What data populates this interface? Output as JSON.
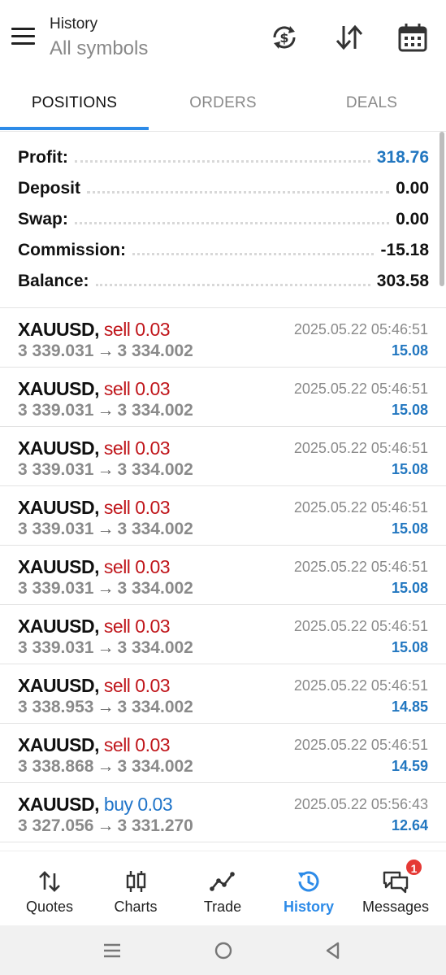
{
  "header": {
    "title": "History",
    "subtitle": "All symbols",
    "icons": [
      "menu-icon",
      "currency-sync-icon",
      "sort-icon",
      "calendar-icon"
    ]
  },
  "tabs": [
    {
      "label": "POSITIONS",
      "active": true
    },
    {
      "label": "ORDERS",
      "active": false
    },
    {
      "label": "DEALS",
      "active": false
    }
  ],
  "summary": {
    "profit_label": "Profit:",
    "profit_value": "318.76",
    "deposit_label": "Deposit",
    "deposit_value": "0.00",
    "swap_label": "Swap:",
    "swap_value": "0.00",
    "commission_label": "Commission:",
    "commission_value": "-15.18",
    "balance_label": "Balance:",
    "balance_value": "303.58"
  },
  "deals": [
    {
      "symbol": "XAUUSD,",
      "side": "sell 0.03",
      "type": "sell",
      "open": "3 339.031",
      "arrow": "→",
      "close": "3 334.002",
      "time": "2025.05.22 05:46:51",
      "profit": "15.08"
    },
    {
      "symbol": "XAUUSD,",
      "side": "sell 0.03",
      "type": "sell",
      "open": "3 339.031",
      "arrow": "→",
      "close": "3 334.002",
      "time": "2025.05.22 05:46:51",
      "profit": "15.08"
    },
    {
      "symbol": "XAUUSD,",
      "side": "sell 0.03",
      "type": "sell",
      "open": "3 339.031",
      "arrow": "→",
      "close": "3 334.002",
      "time": "2025.05.22 05:46:51",
      "profit": "15.08"
    },
    {
      "symbol": "XAUUSD,",
      "side": "sell 0.03",
      "type": "sell",
      "open": "3 339.031",
      "arrow": "→",
      "close": "3 334.002",
      "time": "2025.05.22 05:46:51",
      "profit": "15.08"
    },
    {
      "symbol": "XAUUSD,",
      "side": "sell 0.03",
      "type": "sell",
      "open": "3 339.031",
      "arrow": "→",
      "close": "3 334.002",
      "time": "2025.05.22 05:46:51",
      "profit": "15.08"
    },
    {
      "symbol": "XAUUSD,",
      "side": "sell 0.03",
      "type": "sell",
      "open": "3 339.031",
      "arrow": "→",
      "close": "3 334.002",
      "time": "2025.05.22 05:46:51",
      "profit": "15.08"
    },
    {
      "symbol": "XAUUSD,",
      "side": "sell 0.03",
      "type": "sell",
      "open": "3 338.953",
      "arrow": "→",
      "close": "3 334.002",
      "time": "2025.05.22 05:46:51",
      "profit": "14.85"
    },
    {
      "symbol": "XAUUSD,",
      "side": "sell 0.03",
      "type": "sell",
      "open": "3 338.868",
      "arrow": "→",
      "close": "3 334.002",
      "time": "2025.05.22 05:46:51",
      "profit": "14.59"
    },
    {
      "symbol": "XAUUSD,",
      "side": "buy 0.03",
      "type": "buy",
      "open": "3 327.056",
      "arrow": "→",
      "close": "3 331.270",
      "time": "2025.05.22 05:56:43",
      "profit": "12.64"
    }
  ],
  "bottom_nav": [
    {
      "label": "Quotes",
      "icon": "quotes-arrows-icon",
      "active": false
    },
    {
      "label": "Charts",
      "icon": "candlestick-icon",
      "active": false
    },
    {
      "label": "Trade",
      "icon": "trade-line-icon",
      "active": false
    },
    {
      "label": "History",
      "icon": "history-clock-icon",
      "active": true
    },
    {
      "label": "Messages",
      "icon": "messages-icon",
      "active": false,
      "badge": "1"
    }
  ],
  "colors": {
    "accent": "#2d8be8",
    "profit_blue": "#2277c0",
    "sell_red": "#c0161b",
    "buy_blue": "#1f74c9",
    "badge_red": "#e53935"
  }
}
